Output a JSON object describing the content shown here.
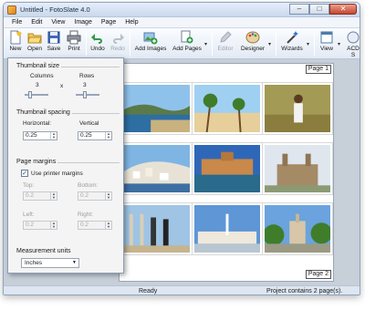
{
  "window": {
    "title": "Untitled - FotoSlate 4.0"
  },
  "menu": [
    "File",
    "Edit",
    "View",
    "Image",
    "Page",
    "Help"
  ],
  "toolbar": {
    "new": "New",
    "open": "Open",
    "save": "Save",
    "print": "Print",
    "undo": "Undo",
    "redo": "Redo",
    "add_images": "Add Images",
    "add_pages": "Add Pages",
    "editor": "Editor",
    "designer": "Designer",
    "wizards": "Wizards",
    "view": "View",
    "acd": "ACD S"
  },
  "panel": {
    "thumb_size": {
      "title": "Thumbnail size",
      "columns_label": "Columns",
      "rows_label": "Rows",
      "columns": "3",
      "times": "x",
      "rows": "3"
    },
    "thumb_spacing": {
      "title": "Thumbnail spacing",
      "horizontal_label": "Horizontal:",
      "vertical_label": "Vertical",
      "horizontal": "0.25",
      "vertical": "0.25"
    },
    "margins": {
      "title": "Page margins",
      "use_printer": "Use printer margins",
      "top_label": "Top:",
      "bottom_label": "Bottom:",
      "left_label": "Left:",
      "right_label": "Right:",
      "top": "0.2",
      "bottom": "0.2",
      "left": "0.2",
      "right": "0.2"
    },
    "units": {
      "title": "Measurement units",
      "value": "Inches"
    }
  },
  "page": {
    "top_label": "Page 1",
    "bottom_label": "Page 2"
  },
  "status": {
    "center": "Ready",
    "right": "Project contains 2 page(s)."
  }
}
